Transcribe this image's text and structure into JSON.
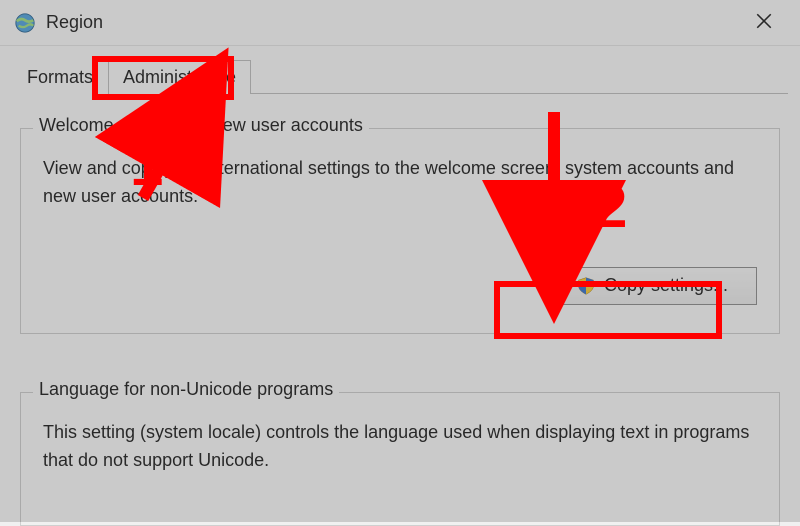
{
  "window": {
    "title": "Region"
  },
  "tabs": {
    "formats": "Formats",
    "administrative": "Administrative"
  },
  "group1": {
    "title": "Welcome screen and new user accounts",
    "desc": "View and copy your international settings to the welcome screen, system accounts and new user accounts.",
    "button": "Copy settings..."
  },
  "group2": {
    "title": "Language for non-Unicode programs",
    "desc": "This setting (system locale) controls the language used when displaying text in programs that do not support Unicode."
  },
  "annot": {
    "n1": "1",
    "n2": "2"
  }
}
